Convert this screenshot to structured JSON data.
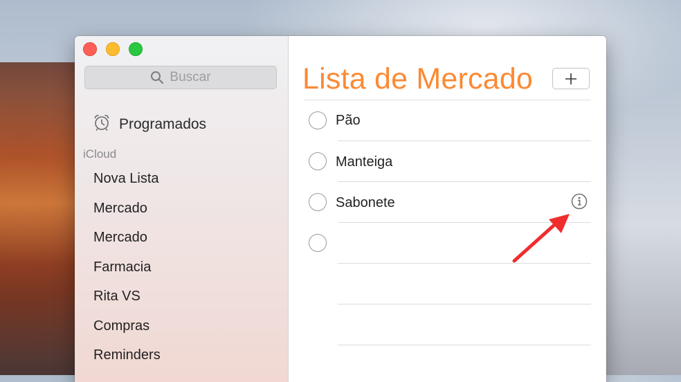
{
  "window": {
    "controls": [
      "close",
      "minimize",
      "zoom"
    ]
  },
  "sidebar": {
    "search_placeholder": "Buscar",
    "scheduled_label": "Programados",
    "section_label": "iCloud",
    "lists": [
      "Nova Lista",
      "Mercado",
      "Mercado",
      "Farmacia",
      "Rita VS",
      "Compras",
      "Reminders"
    ]
  },
  "main": {
    "title": "Lista de Mercado",
    "add_button_label": "+",
    "items": [
      {
        "text": "Pão",
        "completed": false
      },
      {
        "text": "Manteiga",
        "completed": false
      },
      {
        "text": "Sabonete",
        "completed": false,
        "info_visible": true
      },
      {
        "text": "",
        "completed": false
      }
    ]
  },
  "colors": {
    "accent": "#fb8a34",
    "annotation_arrow": "#ef2d2d"
  },
  "icons": {
    "search": "search-icon",
    "scheduled": "alarm-clock-icon",
    "info": "info-icon",
    "annotation": "red-arrow-icon"
  }
}
